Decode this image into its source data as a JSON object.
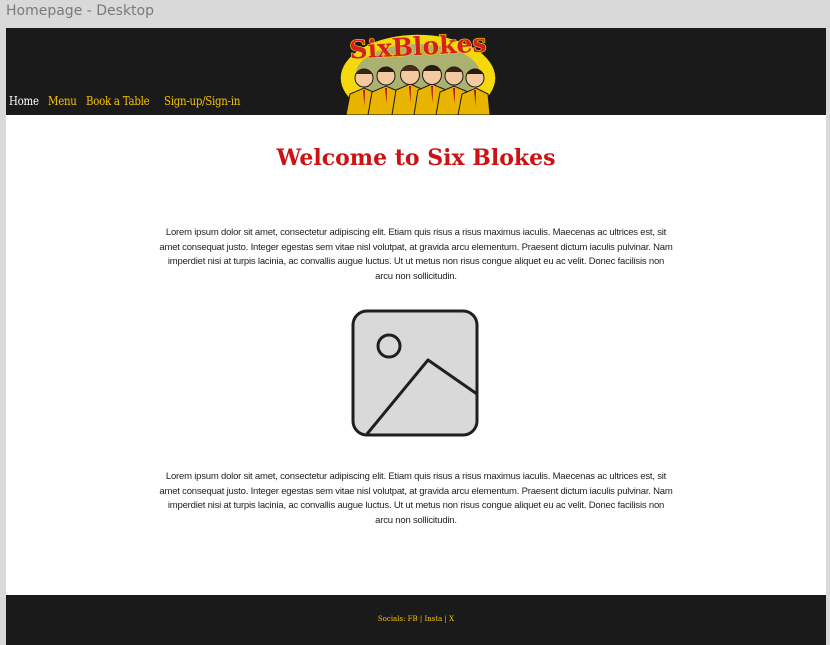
{
  "frame": {
    "title": "Homepage - Desktop"
  },
  "header": {
    "nav": [
      {
        "label": "Home",
        "active": true
      },
      {
        "label": "Menu",
        "active": false
      },
      {
        "label": "Book a Table",
        "active": false
      },
      {
        "label": "Sign-up/Sign-in",
        "active": false
      }
    ],
    "logo_text": "SixBlokes"
  },
  "main": {
    "heading": "Welcome to Six Blokes",
    "paragraph1": "Lorem ipsum dolor sit amet, consectetur adipiscing elit. Etiam quis risus a risus maximus iaculis. Maecenas ac ultrices est, sit amet consequat justo. Integer egestas sem vitae nisl volutpat, at gravida arcu elementum. Praesent dictum iaculis pulvinar. Nam imperdiet nisi at turpis lacinia, ac convallis augue luctus. Ut ut metus non risus congue aliquet eu ac velit. Donec facilisis non arcu non sollicitudin.",
    "image_icon": "image-placeholder-icon",
    "paragraph2": "Lorem ipsum dolor sit amet, consectetur adipiscing elit. Etiam quis risus a risus maximus iaculis. Maecenas ac ultrices est, sit amet consequat justo. Integer egestas sem vitae nisl volutpat, at gravida arcu elementum. Praesent dictum iaculis pulvinar. Nam imperdiet nisi at turpis lacinia, ac convallis augue luctus. Ut ut metus non risus congue aliquet eu ac velit. Donec facilisis non arcu non sollicitudin."
  },
  "footer": {
    "socials": "Socials: FB | Insta | X"
  },
  "colors": {
    "header_bg": "#1b1a1a",
    "nav_text": "#f3c300",
    "nav_active": "#ffffff",
    "heading": "#cc1212",
    "canvas_bg": "#d9d9d9"
  }
}
